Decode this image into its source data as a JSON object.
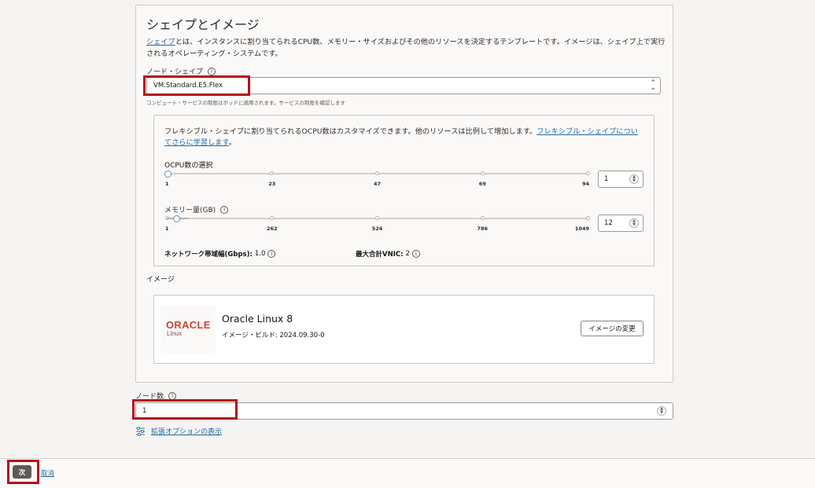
{
  "shape_section": {
    "title": "シェイプとイメージ",
    "intro_link": "シェイプ",
    "intro_text": "とは、インスタンスに割り当てられるCPU数、メモリー・サイズおよびその他のリソースを決定するテンプレートです。イメージは、シェイプ上で実行されるオペレーティング・システムです。",
    "node_shape_label": "ノード・シェイプ",
    "node_shape_value": "VM.Standard.E5.Flex",
    "node_shape_hint": "コンピュート・サービスの制限はポッドに適用されます。サービスの制限を確認します"
  },
  "flex": {
    "text": "フレキシブル・シェイプに割り当てられるOCPU数はカスタマイズできます。他のリソースは比例して増加します。",
    "link": "フレキシブル・シェイプについてさらに学習します",
    "period": "。",
    "ocpu_label": "OCPU数の選択",
    "ocpu_ticks": [
      "1",
      "23",
      "47",
      "69",
      "94"
    ],
    "ocpu_value": "1",
    "ocpu_fraction": 0.0,
    "memory_label": "メモリー量(GB)",
    "memory_ticks": [
      "1",
      "262",
      "524",
      "786",
      "1049"
    ],
    "memory_value": "12",
    "memory_fraction": 0.01,
    "network_label": "ネットワーク帯域幅(Gbps):",
    "network_value": "1.0",
    "vnic_label": "最大合計VNIC:",
    "vnic_value": "2"
  },
  "image": {
    "label": "イメージ",
    "logo_text": "ORACLE",
    "logo_sub": "Linux",
    "name": "Oracle Linux 8",
    "build": "イメージ・ビルド: 2024.09.30-0",
    "change_button": "イメージの変更"
  },
  "nodes": {
    "label": "ノード数",
    "value": "1"
  },
  "advanced": {
    "label": "拡張オプションの表示",
    "icon": "sliders-icon"
  },
  "footer": {
    "next": "次",
    "cancel": "取消"
  },
  "colors": {
    "highlight": "#b5101b",
    "link": "#2368a3",
    "oracle_red": "#c74634"
  }
}
